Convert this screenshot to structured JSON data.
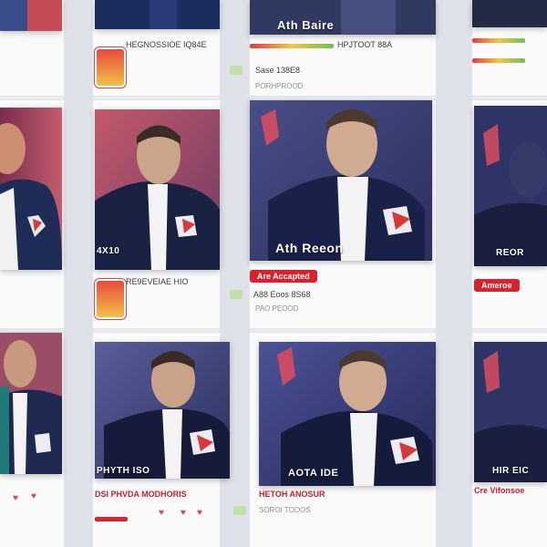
{
  "feed": {
    "cards": [
      {
        "id": "r1c0",
        "caption": ""
      },
      {
        "id": "r1c1",
        "caption": "4X10"
      },
      {
        "id": "r1c2",
        "caption": "Ath Reeon"
      },
      {
        "id": "r1c3",
        "caption": "REOR"
      },
      {
        "id": "r2c0",
        "caption": ""
      },
      {
        "id": "r2c1",
        "caption": "PHYTH ISO"
      },
      {
        "id": "r2c2",
        "caption": "AOTA IDE"
      },
      {
        "id": "r2c3",
        "caption": "HIR EIC"
      }
    ],
    "top": {
      "c2_title": "Ath Baire",
      "c1_meta": "HEGNOSSIOE IQ84E",
      "c2_meta": "HPJTOOT 88A",
      "c2_meta2": "Sase 138E8",
      "c2_sub": "PORHPROOD"
    },
    "mid": {
      "c1_meta": "RE9EVEIAE HIO",
      "c2_badge": "Are Accapted",
      "c2_meta": "A88 Eoos 8S68",
      "c2_sub": "PAO PEOOD",
      "c3_badge": "Ameroe"
    },
    "bottom": {
      "c1_meta": "DSI PHVDA MODHORIS",
      "c2_meta": "HETOH ANOSUR",
      "c3_meta": "Cre Vifonsoe",
      "c2_sub": "SOROI TOOOS"
    }
  },
  "colors": {
    "background": "#e9ebf0",
    "card": "#fafafb",
    "badge_red": "#d9222f"
  }
}
